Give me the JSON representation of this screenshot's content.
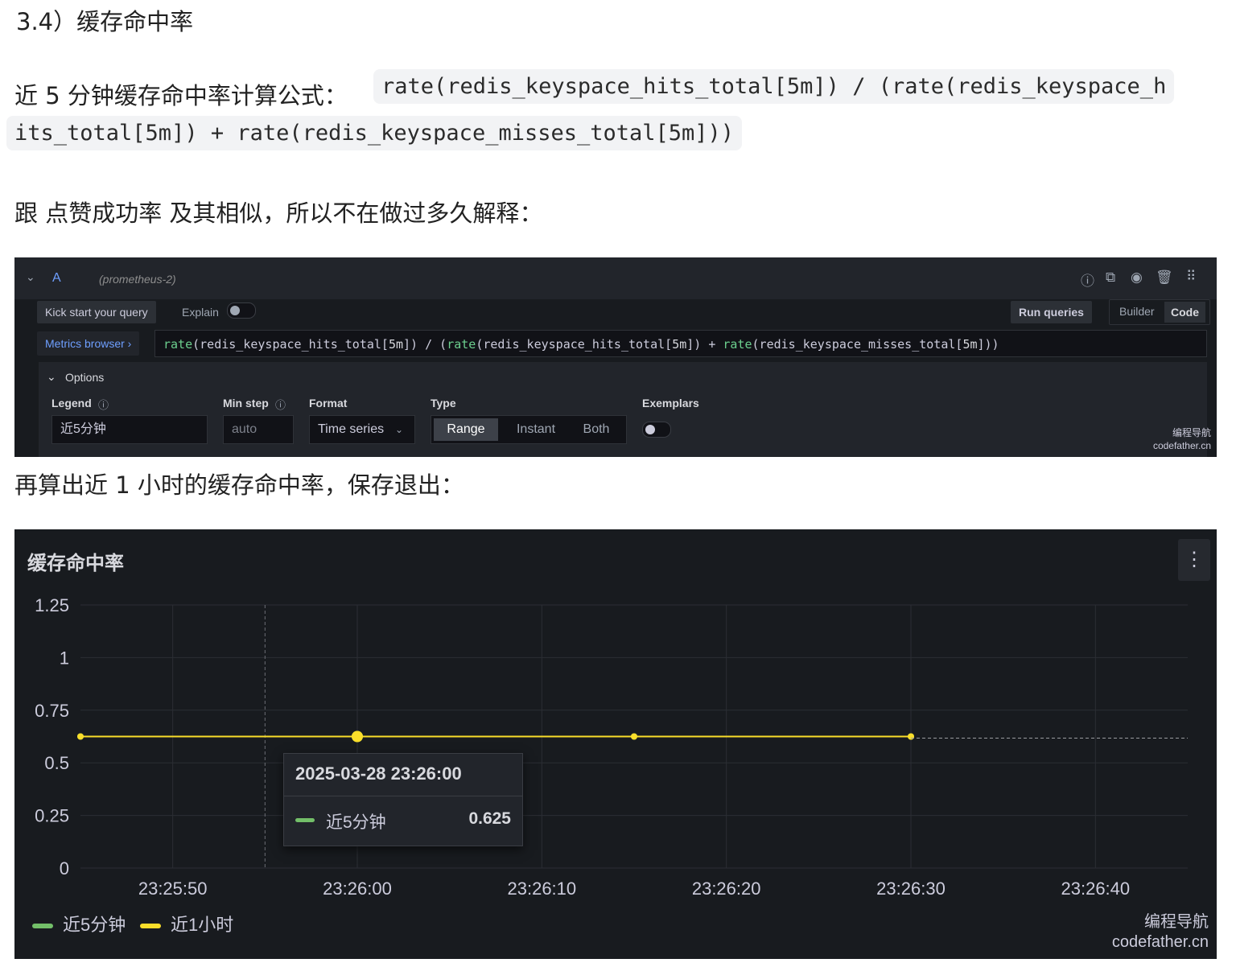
{
  "doc": {
    "heading": "3.4）缓存命中率",
    "formula_label": "近 5 分钟缓存命中率计算公式：",
    "formula_part1": "rate(redis_keyspace_hits_total[5m]) / (rate(redis_keyspace_h",
    "formula_part2": "its_total[5m]) + rate(redis_keyspace_misses_total[5m]))",
    "note": "跟 点赞成功率 及其相似，所以不在做过多久解释：",
    "next": "再算出近 1 小时的缓存命中率，保存退出："
  },
  "query_editor": {
    "collapse_icon": "chevron-down-icon",
    "ref_id": "A",
    "datasource": "(prometheus-2)",
    "kick_start": "Kick start your query",
    "explain": "Explain",
    "run_queries": "Run queries",
    "builder": "Builder",
    "code": "Code",
    "metrics_browser": "Metrics browser ›",
    "query_tokens": [
      {
        "t": "rate",
        "c": "#6ccf8e"
      },
      {
        "t": "(redis_keyspace_hits_total[",
        "c": "#ccccdc"
      },
      {
        "t": "5m",
        "c": "#d8d9de"
      },
      {
        "t": "]) / (",
        "c": "#ccccdc"
      },
      {
        "t": "rate",
        "c": "#6ccf8e"
      },
      {
        "t": "(redis_keyspace_hits_total[",
        "c": "#ccccdc"
      },
      {
        "t": "5m",
        "c": "#d8d9de"
      },
      {
        "t": "]) + ",
        "c": "#ccccdc"
      },
      {
        "t": "rate",
        "c": "#6ccf8e"
      },
      {
        "t": "(redis_keyspace_misses_total[",
        "c": "#ccccdc"
      },
      {
        "t": "5m",
        "c": "#d8d9de"
      },
      {
        "t": "]))",
        "c": "#ccccdc"
      }
    ],
    "options": "Options",
    "legend_label": "Legend",
    "legend_value": "近5分钟",
    "min_step_label": "Min step",
    "min_step_placeholder": "auto",
    "format_label": "Format",
    "format_value": "Time series",
    "type_label": "Type",
    "type_range": "Range",
    "type_instant": "Instant",
    "type_both": "Both",
    "exemplars_label": "Exemplars",
    "watermark1": "编程导航",
    "watermark2": "codefather.cn"
  },
  "graph_panel": {
    "title": "缓存命中率",
    "menu_icon": "more-vertical-icon",
    "tooltip_time": "2025-03-28 23:26:00",
    "tooltip_series": "近5分钟",
    "tooltip_value": "0.625",
    "watermark1": "编程导航",
    "watermark2": "codefather.cn",
    "colors": {
      "series1": "#73bf69",
      "series2": "#fade2a"
    }
  },
  "chart_data": {
    "type": "line",
    "title": "缓存命中率",
    "xlabel": "",
    "ylabel": "",
    "y_ticks": [
      "1.25",
      "1",
      "0.75",
      "0.5",
      "0.25",
      "0"
    ],
    "x_ticks": [
      "23:25:50",
      "23:26:00",
      "23:26:10",
      "23:26:20",
      "23:26:30",
      "23:26:40"
    ],
    "ylim": [
      0,
      1.25
    ],
    "grid": true,
    "legend_position": "bottom-left",
    "series": [
      {
        "name": "近5分钟",
        "x": [
          "23:25:45",
          "23:26:00",
          "23:26:15",
          "23:26:30"
        ],
        "values": [
          0.625,
          0.625,
          0.625,
          0.625
        ]
      },
      {
        "name": "近1小时",
        "x": [
          "23:25:45",
          "23:26:00",
          "23:26:15",
          "23:26:30"
        ],
        "values": [
          0.625,
          0.625,
          0.625,
          0.625
        ]
      }
    ]
  }
}
